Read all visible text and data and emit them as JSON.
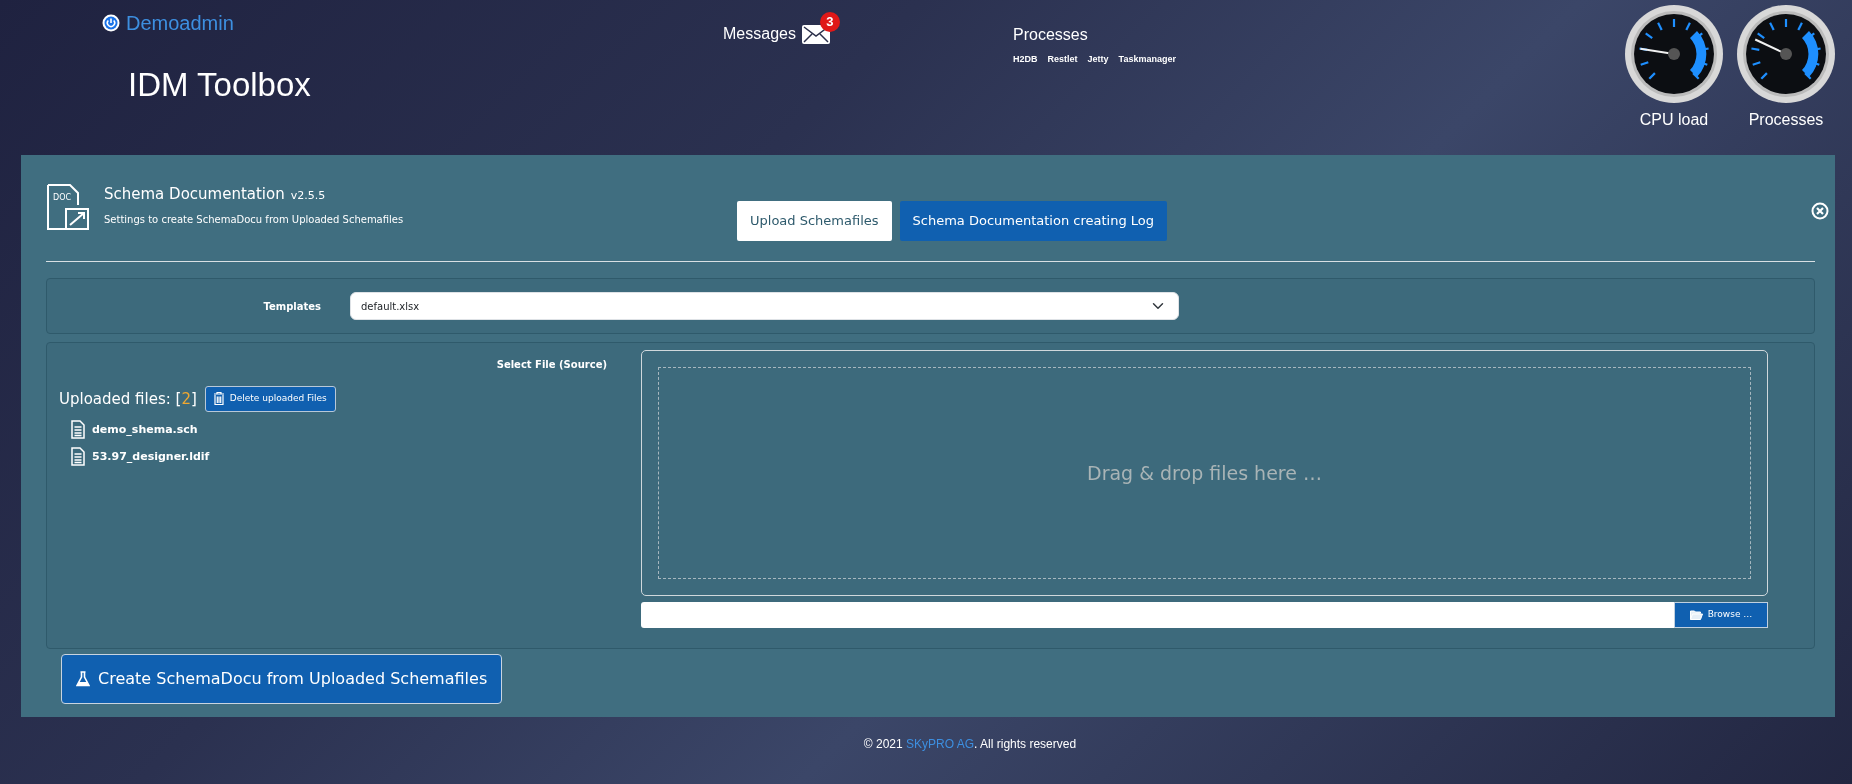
{
  "user": {
    "name": "Demoadmin"
  },
  "app_title": "IDM Toolbox",
  "messages": {
    "label": "Messages",
    "count": "3"
  },
  "processes": {
    "title": "Processes",
    "links": [
      "H2DB",
      "Restlet",
      "Jetty",
      "Taskmanager"
    ]
  },
  "gauges": [
    {
      "label": "CPU load",
      "level": 0.2
    },
    {
      "label": "Processes",
      "level": 0.26
    }
  ],
  "panel": {
    "icon_text": "DOC",
    "title": "Schema Documentation",
    "version": "v2.5.5",
    "subtitle": "Settings to create SchemaDocu from Uploaded Schemafiles",
    "tabs": [
      {
        "label": "Upload Schemafiles",
        "selected": true
      },
      {
        "label": "Schema Documentation creating Log",
        "selected": false
      }
    ]
  },
  "templates": {
    "label": "Templates",
    "value": "default.xlsx"
  },
  "upload": {
    "select_label": "Select File (Source)",
    "heading": {
      "label": "Uploaded files:",
      "open": "[",
      "count": "2",
      "close": "]"
    },
    "delete_button": "Delete uploaded Files",
    "files": [
      "demo_shema.sch",
      "53.97_designer.ldif"
    ],
    "dropzone_text": "Drag & drop files here …",
    "browse_button": "Browse …"
  },
  "create_button": "Create SchemaDocu from Uploaded Schemafiles",
  "footer": {
    "prefix": "© 2021 ",
    "company": "SKyPRO AG",
    "suffix": ". All rights reserved"
  }
}
